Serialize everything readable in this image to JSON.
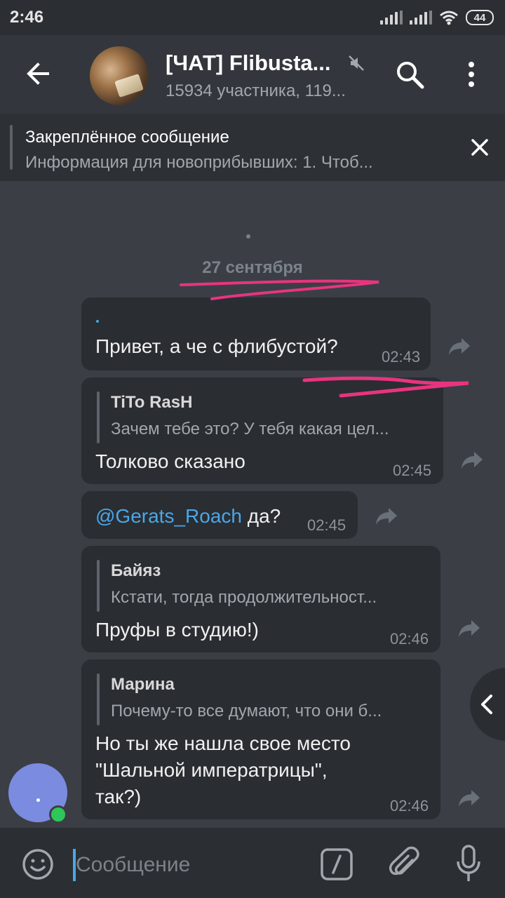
{
  "status_bar": {
    "time": "2:46",
    "battery": "44"
  },
  "header": {
    "title": "[ЧАТ] Flibusta...",
    "subtitle": "15934 участника, 119..."
  },
  "pinned": {
    "title": "Закреплённое сообщение",
    "text": "Информация для новоприбывших:  1. Чтоб..."
  },
  "chat": {
    "date": "27 сентября",
    "messages": [
      {
        "text": "Привет, а че с флибустой?",
        "time": "02:43"
      },
      {
        "reply_name": "TiTo RasH",
        "reply_text": "Зачем тебе это? У тебя какая цел...",
        "text": "Толково сказано",
        "time": "02:45"
      },
      {
        "mention": "@Gerats_Roach",
        "text": " да?",
        "time": "02:45"
      },
      {
        "reply_name": "Байяз",
        "reply_text": "Кстати, тогда продолжительност...",
        "text": "Пруфы в студию!)",
        "time": "02:46"
      },
      {
        "reply_name": "Марина",
        "reply_text": "Почему-то все думают, что они б...",
        "lines": [
          "Но ты же нашла свое место",
          "\"Шальной императрицы\",",
          "так?)"
        ],
        "time": "02:46"
      }
    ]
  },
  "input": {
    "placeholder": "Сообщение"
  },
  "colors": {
    "header_bg": "#33373d",
    "chat_bg": "#3b3f45",
    "bubble_bg": "#2a2d32",
    "mention": "#4aa7e8",
    "annotation": "#e8347f",
    "online": "#2ec75a",
    "avatar": "#7b8be0"
  }
}
